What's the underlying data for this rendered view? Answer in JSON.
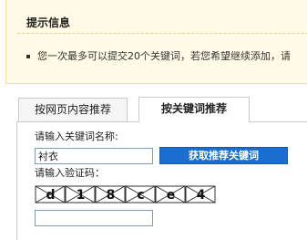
{
  "notice": {
    "title": "提示信息",
    "message": "您一次最多可以提交20个关键词，若您希望继续添加，请"
  },
  "tabs": [
    {
      "label": "按网页内容推荐",
      "active": false
    },
    {
      "label": "按关键词推荐",
      "active": true
    }
  ],
  "form": {
    "keyword_label": "请输入关键词名称:",
    "keyword_value": "衬衣",
    "get_button_label": "获取推荐关键词",
    "verify_label": "请输入验证码：",
    "verify_value": "",
    "captcha_text": [
      "d",
      "1",
      "8",
      "c",
      "e",
      "4"
    ]
  },
  "colors": {
    "notice_bg": "#fffbe6",
    "button_bg": "#1a6ed0",
    "input_border": "#7aa0b8"
  }
}
